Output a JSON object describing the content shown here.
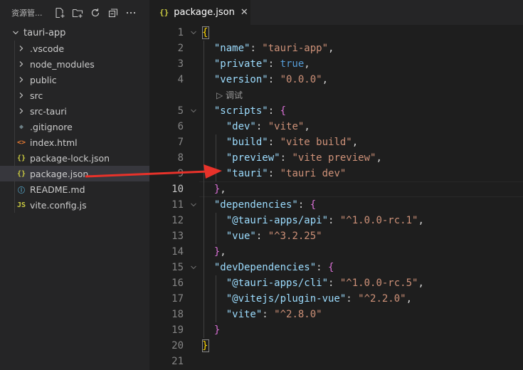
{
  "sidebar": {
    "title": "资源管...",
    "root": "tauri-app",
    "items": [
      {
        "label": ".vscode",
        "type": "folder",
        "icon": "chevron-right-icon"
      },
      {
        "label": "node_modules",
        "type": "folder",
        "icon": "chevron-right-icon"
      },
      {
        "label": "public",
        "type": "folder",
        "icon": "chevron-right-icon"
      },
      {
        "label": "src",
        "type": "folder",
        "icon": "chevron-right-icon"
      },
      {
        "label": "src-tauri",
        "type": "folder",
        "icon": "chevron-right-icon"
      },
      {
        "label": ".gitignore",
        "type": "file",
        "icon": "git-icon",
        "glyph": "◆",
        "color": "#6d8086"
      },
      {
        "label": "index.html",
        "type": "file",
        "icon": "html-icon",
        "glyph": "<>",
        "color": "#e37933"
      },
      {
        "label": "package-lock.json",
        "type": "file",
        "icon": "json-icon",
        "glyph": "{}",
        "color": "#cbcb41"
      },
      {
        "label": "package.json",
        "type": "file",
        "icon": "json-icon",
        "glyph": "{}",
        "color": "#cbcb41",
        "selected": true
      },
      {
        "label": "README.md",
        "type": "file",
        "icon": "info-icon",
        "glyph": "ⓘ",
        "color": "#519aba"
      },
      {
        "label": "vite.config.js",
        "type": "file",
        "icon": "js-icon",
        "glyph": "JS",
        "color": "#cbcb41"
      }
    ]
  },
  "tab": {
    "icon": "{}",
    "label": "package.json",
    "close": "✕"
  },
  "codelens": "▷ 调试",
  "editor": {
    "active_line": 10,
    "lines": [
      {
        "n": "1",
        "fold": true,
        "tokens": [
          [
            "{",
            "y"
          ]
        ]
      },
      {
        "n": "2",
        "tokens": [
          [
            "  ",
            "p"
          ],
          [
            "\"name\"",
            "k"
          ],
          [
            ": ",
            "p"
          ],
          [
            "\"tauri-app\"",
            "s"
          ],
          [
            ",",
            "p"
          ]
        ]
      },
      {
        "n": "3",
        "tokens": [
          [
            "  ",
            "p"
          ],
          [
            "\"private\"",
            "k"
          ],
          [
            ": ",
            "p"
          ],
          [
            "true",
            "b"
          ],
          [
            ",",
            "p"
          ]
        ]
      },
      {
        "n": "4",
        "tokens": [
          [
            "  ",
            "p"
          ],
          [
            "\"version\"",
            "k"
          ],
          [
            ": ",
            "p"
          ],
          [
            "\"0.0.0\"",
            "s"
          ],
          [
            ",",
            "p"
          ]
        ]
      },
      {
        "n": "5",
        "fold": true,
        "tokens": [
          [
            "  ",
            "p"
          ],
          [
            "\"scripts\"",
            "k"
          ],
          [
            ": ",
            "p"
          ],
          [
            "{",
            "m"
          ]
        ]
      },
      {
        "n": "6",
        "tokens": [
          [
            "    ",
            "p"
          ],
          [
            "\"dev\"",
            "k"
          ],
          [
            ": ",
            "p"
          ],
          [
            "\"vite\"",
            "s"
          ],
          [
            ",",
            "p"
          ]
        ]
      },
      {
        "n": "7",
        "tokens": [
          [
            "    ",
            "p"
          ],
          [
            "\"build\"",
            "k"
          ],
          [
            ": ",
            "p"
          ],
          [
            "\"vite build\"",
            "s"
          ],
          [
            ",",
            "p"
          ]
        ]
      },
      {
        "n": "8",
        "tokens": [
          [
            "    ",
            "p"
          ],
          [
            "\"preview\"",
            "k"
          ],
          [
            ": ",
            "p"
          ],
          [
            "\"vite preview\"",
            "s"
          ],
          [
            ",",
            "p"
          ]
        ]
      },
      {
        "n": "9",
        "tokens": [
          [
            "    ",
            "p"
          ],
          [
            "\"tauri\"",
            "k"
          ],
          [
            ": ",
            "p"
          ],
          [
            "\"tauri dev\"",
            "s"
          ]
        ]
      },
      {
        "n": "10",
        "tokens": [
          [
            "  ",
            "p"
          ],
          [
            "}",
            "m"
          ],
          [
            ",",
            "p"
          ]
        ]
      },
      {
        "n": "11",
        "fold": true,
        "tokens": [
          [
            "  ",
            "p"
          ],
          [
            "\"dependencies\"",
            "k"
          ],
          [
            ": ",
            "p"
          ],
          [
            "{",
            "m"
          ]
        ]
      },
      {
        "n": "12",
        "tokens": [
          [
            "    ",
            "p"
          ],
          [
            "\"@tauri-apps/api\"",
            "k"
          ],
          [
            ": ",
            "p"
          ],
          [
            "\"^1.0.0-rc.1\"",
            "s"
          ],
          [
            ",",
            "p"
          ]
        ]
      },
      {
        "n": "13",
        "tokens": [
          [
            "    ",
            "p"
          ],
          [
            "\"vue\"",
            "k"
          ],
          [
            ": ",
            "p"
          ],
          [
            "\"^3.2.25\"",
            "s"
          ]
        ]
      },
      {
        "n": "14",
        "tokens": [
          [
            "  ",
            "p"
          ],
          [
            "}",
            "m"
          ],
          [
            ",",
            "p"
          ]
        ]
      },
      {
        "n": "15",
        "fold": true,
        "tokens": [
          [
            "  ",
            "p"
          ],
          [
            "\"devDependencies\"",
            "k"
          ],
          [
            ": ",
            "p"
          ],
          [
            "{",
            "m"
          ]
        ]
      },
      {
        "n": "16",
        "tokens": [
          [
            "    ",
            "p"
          ],
          [
            "\"@tauri-apps/cli\"",
            "k"
          ],
          [
            ": ",
            "p"
          ],
          [
            "\"^1.0.0-rc.5\"",
            "s"
          ],
          [
            ",",
            "p"
          ]
        ]
      },
      {
        "n": "17",
        "tokens": [
          [
            "    ",
            "p"
          ],
          [
            "\"@vitejs/plugin-vue\"",
            "k"
          ],
          [
            ": ",
            "p"
          ],
          [
            "\"^2.2.0\"",
            "s"
          ],
          [
            ",",
            "p"
          ]
        ]
      },
      {
        "n": "18",
        "tokens": [
          [
            "    ",
            "p"
          ],
          [
            "\"vite\"",
            "k"
          ],
          [
            ": ",
            "p"
          ],
          [
            "\"^2.8.0\"",
            "s"
          ]
        ]
      },
      {
        "n": "19",
        "tokens": [
          [
            "  ",
            "p"
          ],
          [
            "}",
            "m"
          ]
        ]
      },
      {
        "n": "20",
        "tokens": [
          [
            "}",
            "y"
          ]
        ]
      },
      {
        "n": "21",
        "tokens": []
      }
    ]
  },
  "annotation": {
    "color": "#e8322a"
  }
}
